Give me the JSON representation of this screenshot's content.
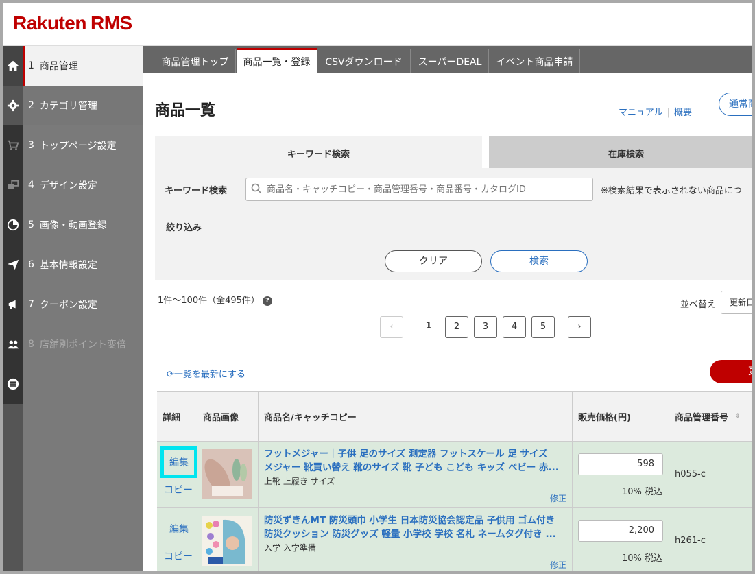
{
  "app": {
    "logo_brand": "Rakuten",
    "logo_product": "RMS"
  },
  "sidebar": {
    "items": [
      {
        "num": "1",
        "label": "商品管理"
      },
      {
        "num": "2",
        "label": "カテゴリ管理"
      },
      {
        "num": "3",
        "label": "トップページ設定"
      },
      {
        "num": "4",
        "label": "デザイン設定"
      },
      {
        "num": "5",
        "label": "画像・動画登録"
      },
      {
        "num": "6",
        "label": "基本情報設定"
      },
      {
        "num": "7",
        "label": "クーポン設定"
      },
      {
        "num": "8",
        "label": "店舗別ポイント変倍"
      }
    ]
  },
  "tabs": [
    "商品管理トップ",
    "商品一覧・登録",
    "CSVダウンロード",
    "スーパーDEAL",
    "イベント商品申請"
  ],
  "page": {
    "title": "商品一覧",
    "link_manual": "マニュアル",
    "link_overview": "概要",
    "normal_btn": "通常商"
  },
  "search": {
    "tab_keyword": "キーワード検索",
    "tab_stock": "在庫検索",
    "keyword_label": "キーワード検索",
    "keyword_placeholder": "商品名・キャッチコピー・商品管理番号・商品番号・カタログID",
    "note": "※検索結果で表示されない商品につ",
    "filter_label": "絞り込み",
    "clear_btn": "クリア",
    "search_btn": "検索"
  },
  "results": {
    "count": "1件～100件（全495件）",
    "sort_label": "並べ替え",
    "sort_value": "更新日",
    "pages": [
      "1",
      "2",
      "3",
      "4",
      "5"
    ],
    "prev": "‹",
    "next": "›",
    "refresh": "一覧を最新にする",
    "red_btn": "更"
  },
  "table": {
    "headers": [
      "詳細",
      "商品画像",
      "商品名/キャッチコピー",
      "販売価格(円)",
      "商品管理番号"
    ],
    "edit_label": "編集",
    "copy_label": "コピー",
    "fix_label": "修正",
    "rows": [
      {
        "name_line1": "フットメジャー｜子供 足のサイズ 測定器 フットスケール 足 サイズ",
        "name_line2": "メジャー 靴買い替え 靴のサイズ 靴 子ども こども キッズ ベビー 赤...",
        "catch": "上靴 上履き サイズ",
        "price": "598",
        "tax": "10% 税込",
        "mgmt_no": "h055-c"
      },
      {
        "name_line1": "防災ずきんMT 防災頭巾 小学生 日本防災協会認定品 子供用 ゴム付き",
        "name_line2": "防災クッション 防災グッズ 軽量 小学校 学校 名札 ネームタグ付き ...",
        "catch": "入学 入学準備",
        "price": "2,200",
        "tax": "10% 税込",
        "mgmt_no": "h261-c"
      }
    ]
  },
  "colors": {
    "brand_red": "#bf0000",
    "link_blue": "#2a6fbf",
    "highlight": "#00e5ef",
    "row_green": "#dceadd"
  }
}
